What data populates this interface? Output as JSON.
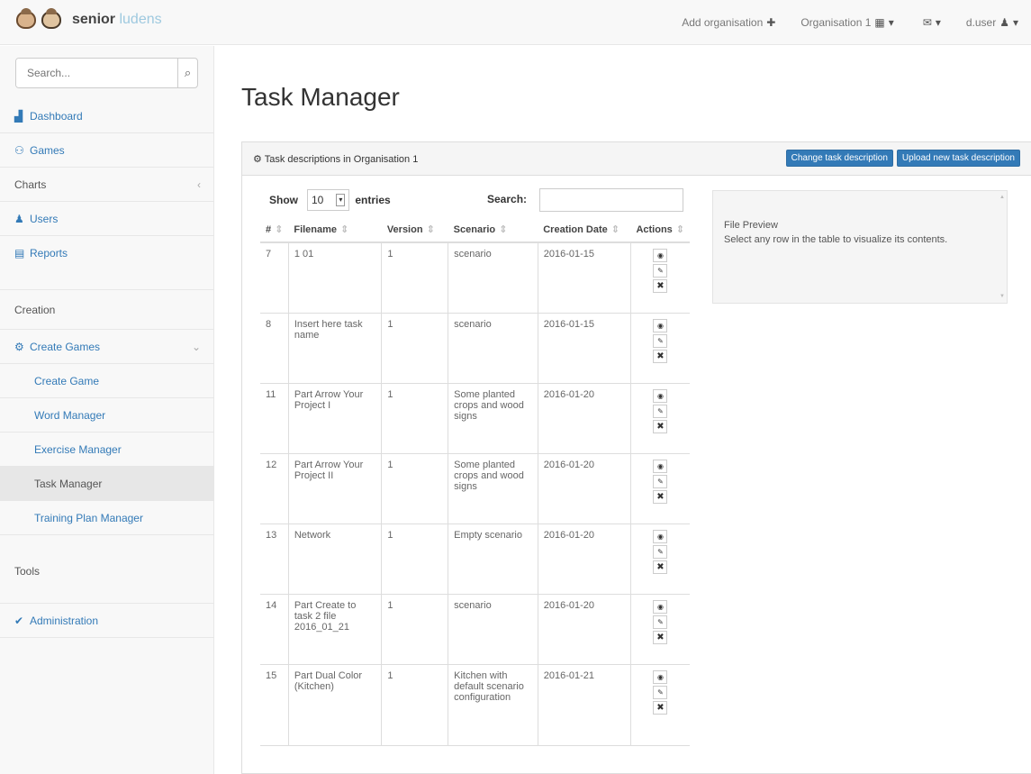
{
  "brand": {
    "name_bold": "senior",
    "name_light": "ludens"
  },
  "topnav": {
    "add_org": "Add organisation",
    "org": "Organisation 1",
    "user": "d.user"
  },
  "sidebar": {
    "search_placeholder": "Search...",
    "items": [
      {
        "label": "Dashboard",
        "icon": "chart"
      },
      {
        "label": "Games",
        "icon": "gamepad"
      },
      {
        "label": "Charts"
      },
      {
        "label": "Users",
        "icon": "users"
      },
      {
        "label": "Reports",
        "icon": "report"
      },
      {
        "label": "Creation"
      },
      {
        "label": "Create Games",
        "icon": "gear"
      },
      {
        "label": "Create Game"
      },
      {
        "label": "Word Manager"
      },
      {
        "label": "Exercise Manager"
      },
      {
        "label": "Task Manager"
      },
      {
        "label": "Training Plan Manager"
      },
      {
        "label": "Tools"
      },
      {
        "label": "Administration",
        "icon": "check"
      }
    ]
  },
  "page": {
    "title": "Task Manager"
  },
  "panel": {
    "title": "Task descriptions in Organisation 1",
    "btn_change": "Change task description",
    "btn_upload": "Upload new task description"
  },
  "table_controls": {
    "show": "Show",
    "entries_value": "10",
    "entries": "entries",
    "search": "Search:"
  },
  "table": {
    "headers": {
      "id": "#",
      "filename": "Filename",
      "version": "Version",
      "scenario": "Scenario",
      "date": "Creation Date",
      "actions": "Actions"
    },
    "rows": [
      {
        "id": "7",
        "filename": "1 01",
        "version": "1",
        "scenario": "scenario",
        "date": "2016-01-15"
      },
      {
        "id": "8",
        "filename": "Insert here task name",
        "version": "1",
        "scenario": "scenario",
        "date": "2016-01-15"
      },
      {
        "id": "11",
        "filename": "Part Arrow Your Project I",
        "version": "1",
        "scenario": "Some planted crops and wood signs",
        "date": "2016-01-20"
      },
      {
        "id": "12",
        "filename": "Part Arrow Your Project II",
        "version": "1",
        "scenario": "Some planted crops and wood signs",
        "date": "2016-01-20"
      },
      {
        "id": "13",
        "filename": "Network",
        "version": "1",
        "scenario": "Empty scenario",
        "date": "2016-01-20"
      },
      {
        "id": "14",
        "filename": "Part Create to task 2 file 2016_01_21",
        "version": "1",
        "scenario": "scenario",
        "date": "2016-01-20"
      },
      {
        "id": "15",
        "filename": "Part Dual Color (Kitchen)",
        "version": "1",
        "scenario": "Kitchen with default scenario configuration",
        "date": "2016-01-21"
      }
    ]
  },
  "preview": {
    "title": "File Preview",
    "text": "Select any row in the table to visualize its contents."
  }
}
